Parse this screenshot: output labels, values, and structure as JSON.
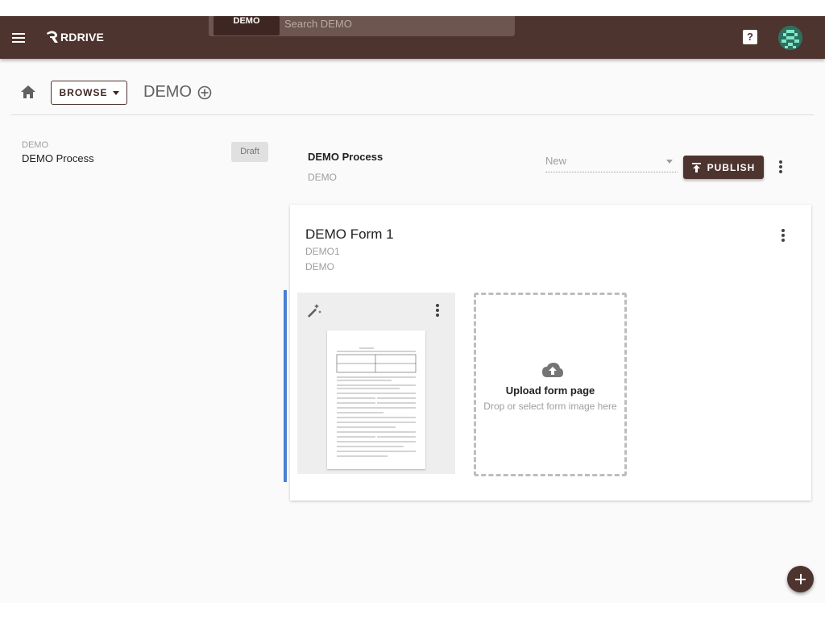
{
  "header": {
    "brand": "RDRIVE",
    "search": {
      "scope_chip": "DEMO",
      "placeholder": "Search DEMO"
    },
    "help_label": "?"
  },
  "breadcrumb": {
    "browse_label": "BROWSE",
    "title": "DEMO"
  },
  "process_list": [
    {
      "category": "DEMO",
      "name": "DEMO Process",
      "status": "Draft"
    }
  ],
  "process_detail": {
    "title": "DEMO Process",
    "code": "DEMO",
    "status_value": "New",
    "publish_label": "PUBLISH"
  },
  "form": {
    "title": "DEMO Form 1",
    "code": "DEMO1",
    "category": "DEMO",
    "upload": {
      "title": "Upload form page",
      "subtitle": "Drop or select form image here"
    }
  },
  "colors": {
    "primary": "#4e342e",
    "accent_bar": "#4a7fd4",
    "background": "#fafafa"
  },
  "icons": [
    "menu-icon",
    "logo-icon",
    "help-icon",
    "avatar",
    "home-icon",
    "caret-down-icon",
    "add-circle-icon",
    "publish-icon",
    "more-vert-icon",
    "magic-wand-icon",
    "cloud-upload-icon",
    "add-icon"
  ]
}
